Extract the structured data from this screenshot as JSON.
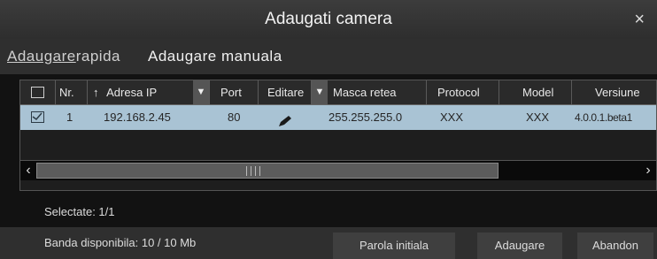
{
  "dialog": {
    "title": "Adaugati camera",
    "close_glyph": "×"
  },
  "tabs": {
    "quick_underlined": "Adaugare",
    "quick_rest": "rapida",
    "manual": "Adaugare manuala"
  },
  "table": {
    "headers": {
      "no": "Nr.",
      "ip_arrow": "↑",
      "ip": "Adresa IP",
      "port": "Port",
      "edit": "Editare",
      "mask": "Masca retea",
      "protocol": "Protocol",
      "model": "Model",
      "version": "Versiune"
    },
    "rows": [
      {
        "checked": true,
        "no": "1",
        "ip": "192.168.2.45",
        "port": "80",
        "edit_icon": "pencil-icon",
        "mask": "255.255.255.0",
        "protocol": "XXX",
        "model": "XXX",
        "version": "4.0.0.1.beta1"
      }
    ]
  },
  "status": {
    "selected": "Selectate: 1/1",
    "bandwidth": "Banda disponibila: 10 / 10 Mb"
  },
  "buttons": {
    "initial_password": "Parola initiala",
    "add": "Adaugare",
    "cancel": "Abandon"
  },
  "colors": {
    "selected_row": "#a9c3d4",
    "title_bar": "#3c3c3c",
    "background": "#121212"
  }
}
